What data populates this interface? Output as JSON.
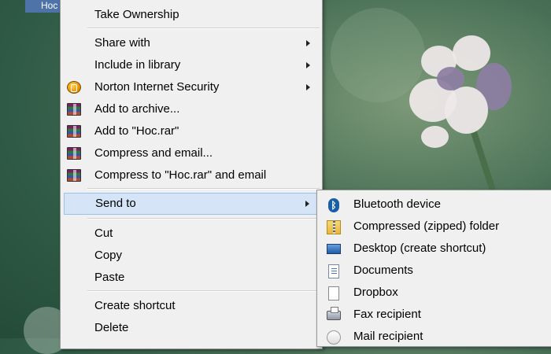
{
  "desktop": {
    "selected_item_label": "Hoc"
  },
  "context_menu": {
    "items": [
      {
        "label": "Take Ownership",
        "icon": "",
        "arrow": false
      },
      {
        "label": "Share with",
        "icon": "",
        "arrow": true
      },
      {
        "label": "Include in library",
        "icon": "",
        "arrow": true
      },
      {
        "label": "Norton Internet Security",
        "icon": "norton-icon",
        "arrow": true
      },
      {
        "label": "Add to archive...",
        "icon": "winrar-icon",
        "arrow": false
      },
      {
        "label": "Add to \"Hoc.rar\"",
        "icon": "winrar-icon",
        "arrow": false
      },
      {
        "label": "Compress and email...",
        "icon": "winrar-icon",
        "arrow": false
      },
      {
        "label": "Compress to \"Hoc.rar\" and email",
        "icon": "winrar-icon",
        "arrow": false
      },
      {
        "label": "Send to",
        "icon": "",
        "arrow": true,
        "selected": true
      },
      {
        "label": "Cut",
        "icon": "",
        "arrow": false
      },
      {
        "label": "Copy",
        "icon": "",
        "arrow": false
      },
      {
        "label": "Paste",
        "icon": "",
        "arrow": false
      },
      {
        "label": "Create shortcut",
        "icon": "",
        "arrow": false
      },
      {
        "label": "Delete",
        "icon": "",
        "arrow": false
      }
    ]
  },
  "send_to_menu": {
    "items": [
      {
        "label": "Bluetooth device",
        "icon": "bluetooth-icon"
      },
      {
        "label": "Compressed (zipped) folder",
        "icon": "zip-folder-icon"
      },
      {
        "label": "Desktop (create shortcut)",
        "icon": "desktop-icon"
      },
      {
        "label": "Documents",
        "icon": "documents-icon"
      },
      {
        "label": "Dropbox",
        "icon": "dropbox-icon"
      },
      {
        "label": "Fax recipient",
        "icon": "fax-icon"
      },
      {
        "label": "Mail recipient",
        "icon": "mail-icon"
      }
    ]
  },
  "colors": {
    "menu_bg": "#f0f0f0",
    "highlight_bg": "#d5e5f7",
    "highlight_border": "#99c1ea"
  }
}
